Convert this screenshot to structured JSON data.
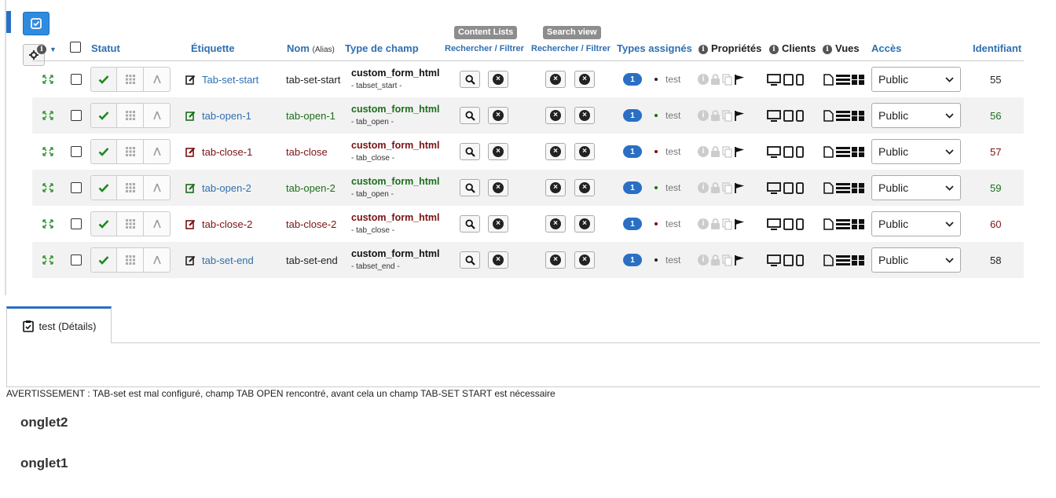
{
  "headers": {
    "statut": "Statut",
    "etiquette": "Étiquette",
    "nom": "Nom",
    "nom_alias": "(Alias)",
    "type_champ": "Type de champ",
    "content_lists": "Content Lists",
    "search_view": "Search view",
    "rechercher_filtrer_1": "Rechercher / Filtrer",
    "rechercher_filtrer_2": "Rechercher / Filtrer",
    "types_assignes": "Types assignés",
    "proprietes": "Propriétés",
    "clients": "Clients",
    "vues": "Vues",
    "acces": "Accès",
    "identifiant": "Identifiant"
  },
  "rows": [
    {
      "label": "Tab-set-start",
      "name": "tab-set-start",
      "type": "custom_form_html",
      "subtype": "- tabset_start -",
      "count": "1",
      "assigned": "test",
      "access": "Public",
      "id": "55",
      "tone": "black"
    },
    {
      "label": "tab-open-1",
      "name": "tab-open-1",
      "type": "custom_form_html",
      "subtype": "- tab_open -",
      "count": "1",
      "assigned": "test",
      "access": "Public",
      "id": "56",
      "tone": "green"
    },
    {
      "label": "tab-close-1",
      "name": "tab-close",
      "type": "custom_form_html",
      "subtype": "- tab_close -",
      "count": "1",
      "assigned": "test",
      "access": "Public",
      "id": "57",
      "tone": "red"
    },
    {
      "label": "tab-open-2",
      "name": "tab-open-2",
      "type": "custom_form_html",
      "subtype": "- tab_open -",
      "count": "1",
      "assigned": "test",
      "access": "Public",
      "id": "59",
      "tone": "green"
    },
    {
      "label": "tab-close-2",
      "name": "tab-close-2",
      "type": "custom_form_html",
      "subtype": "- tab_close -",
      "count": "1",
      "assigned": "test",
      "access": "Public",
      "id": "60",
      "tone": "red"
    },
    {
      "label": "tab-set-end",
      "name": "tab-set-end",
      "type": "custom_form_html",
      "subtype": "- tabset_end -",
      "count": "1",
      "assigned": "test",
      "access": "Public",
      "id": "58",
      "tone": "black"
    }
  ],
  "details_tab": {
    "label": "test (Détails)"
  },
  "warning": "AVERTISSEMENT : TAB-set est mal configuré, champ TAB OPEN rencontré, avant cela un champ TAB-SET START est nécessaire",
  "onglets": [
    "onglet2",
    "onglet1"
  ],
  "colors": {
    "accent": "#2a6fc4",
    "link": "#2f6fb0",
    "green": "#1b6e1b",
    "red": "#7a1212"
  }
}
